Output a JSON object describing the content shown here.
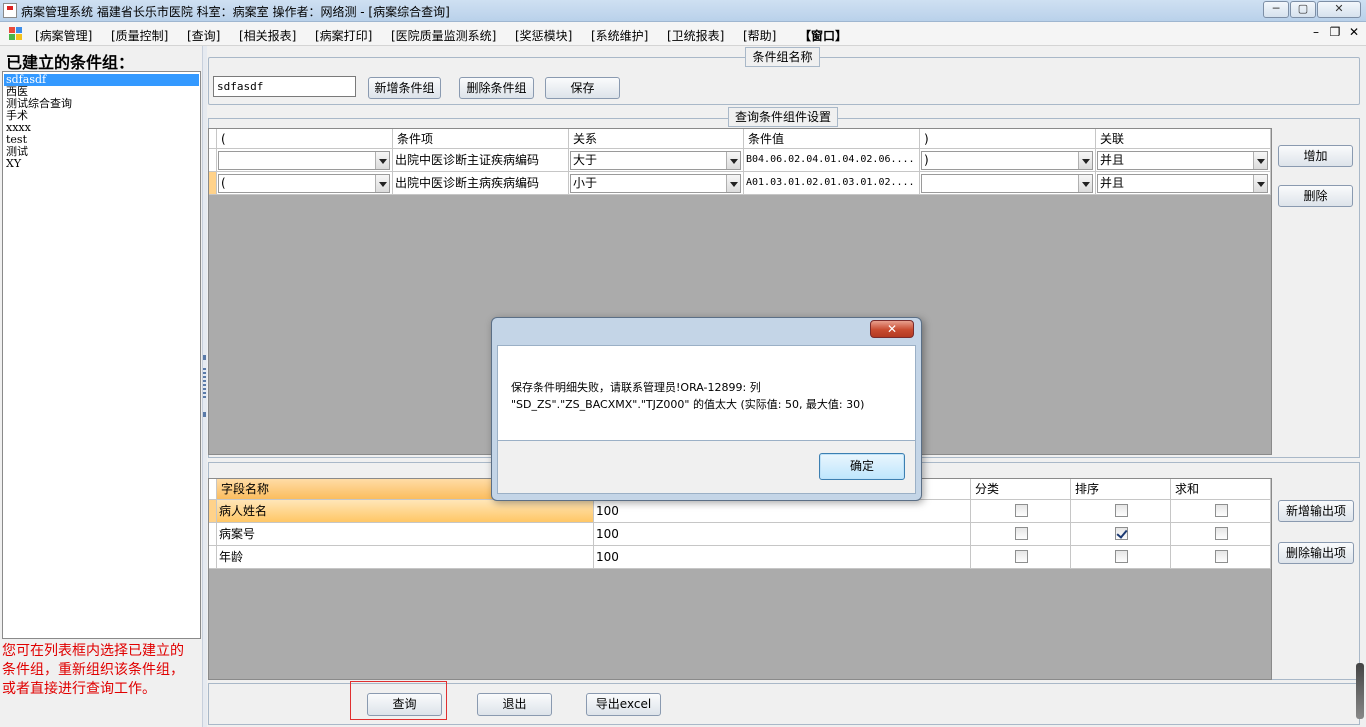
{
  "window": {
    "title": "病案管理系统  福建省长乐市医院  科室：病案室 操作者：网络测 - [病案综合查询]",
    "controls": {
      "minimize": "─",
      "maximize": "▢",
      "close": "✕"
    }
  },
  "menu": {
    "items": [
      "[病案管理]",
      "[质量控制]",
      "[查询]",
      "[相关报表]",
      "[病案打印]",
      "[医院质量监测系统]",
      "[奖惩模块]",
      "[系统维护]",
      "[卫统报表]",
      "[帮助]",
      "【窗口】"
    ],
    "mdi_controls": {
      "minimize": "–",
      "restore": "❐",
      "close": "✕"
    }
  },
  "left_panel": {
    "title": "已建立的条件组：",
    "groups": [
      "sdfasdf",
      "西医",
      "测试综合查询",
      "手术",
      "xxxx",
      "test",
      "测试",
      "XY"
    ],
    "selected_index": 0,
    "hint": "您可在列表框内选择已建立的条件组，重新组织该条件组，或者直接进行查询工作。"
  },
  "group_name": {
    "legend": "条件组名称",
    "value": "sdfasdf",
    "buttons": {
      "add": "新增条件组",
      "delete": "删除条件组",
      "save": "保存"
    }
  },
  "conditions": {
    "legend": "查询条件组件设置",
    "columns": [
      "(",
      "条件项",
      "关系",
      "条件值",
      ")",
      "关联"
    ],
    "rows": [
      {
        "open": "",
        "item": "出院中医诊断主证疾病编码",
        "relation": "大于",
        "value": "B04.06.02.04.01.04.02.06....",
        "close": ")",
        "link": "并且"
      },
      {
        "open": "(",
        "item": "出院中医诊断主病疾病编码",
        "relation": "小于",
        "value": "A01.03.01.02.01.03.01.02....",
        "close": "",
        "link": "并且"
      }
    ],
    "buttons": {
      "add": "增加",
      "delete": "删除"
    }
  },
  "output": {
    "columns": [
      "字段名称",
      "",
      "分类",
      "排序",
      "求和"
    ],
    "rows": [
      {
        "field": "病人姓名",
        "width": "100",
        "category": false,
        "sort": false,
        "sum": false
      },
      {
        "field": "病案号",
        "width": "100",
        "category": false,
        "sort": true,
        "sum": false
      },
      {
        "field": "年龄",
        "width": "100",
        "category": false,
        "sort": false,
        "sum": false
      }
    ],
    "buttons": {
      "add": "新增输出项",
      "delete": "删除输出项"
    }
  },
  "bottom": {
    "buttons": {
      "query": "查询",
      "exit": "退出",
      "export": "导出excel"
    }
  },
  "dialog": {
    "close": "✕",
    "message": "保存条件明细失败，请联系管理员!ORA-12899: 列\n\"SD_ZS\".\"ZS_BACXMX\".\"TJZ000\" 的值太大 (实际值: 50, 最大值: 30)",
    "ok": "确定"
  }
}
